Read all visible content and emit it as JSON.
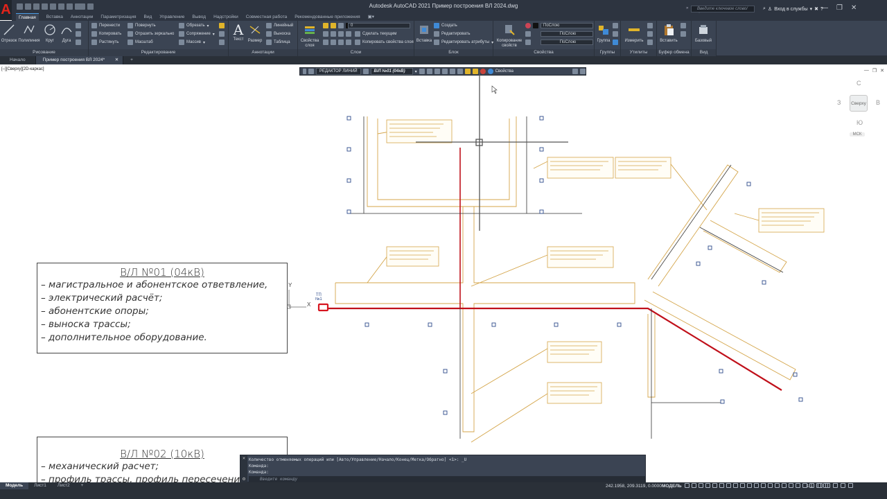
{
  "app": {
    "logo_letter": "A",
    "title": "Autodesk AutoCAD 2021    Пример построения ВЛ 2024.dwg",
    "search_placeholder": "Введите ключевое слово/фразу",
    "signin": "Вход в службы",
    "window_controls": [
      "—",
      "❐",
      "✕"
    ]
  },
  "ribbon_tabs": [
    "Главная",
    "Вставка",
    "Аннотации",
    "Параметризация",
    "Вид",
    "Управление",
    "Вывод",
    "Надстройки",
    "Совместная работа",
    "Рекомендованные приложения"
  ],
  "ribbon_active_tab": "Главная",
  "ribbon": {
    "draw": {
      "title": "Рисование",
      "buttons": [
        "Отрезок",
        "Полилиния",
        "Круг",
        "Дуга"
      ]
    },
    "modify": {
      "title": "Редактирование",
      "col1": [
        "Перенести",
        "Копировать",
        "Растянуть"
      ],
      "col2": [
        "Повернуть",
        "Отразить зеркально",
        "Масштаб"
      ],
      "col3": [
        "Обрезать",
        "Сопряжение",
        "Массив"
      ]
    },
    "annotation": {
      "title": "Аннотации",
      "buttons": [
        "Текст",
        "Размер"
      ],
      "small": [
        "Линейный",
        "Выноска",
        "Таблица"
      ]
    },
    "layers": {
      "title": "Слои",
      "big": "Свойства слоя",
      "layer_value": "0",
      "small": [
        "Сделать текущим",
        "Копировать свойства слоя"
      ]
    },
    "block": {
      "title": "Блок",
      "big": "Вставка",
      "small": [
        "Создать",
        "Редактировать",
        "Редактировать атрибуты"
      ]
    },
    "properties": {
      "title": "Свойства",
      "big": "Копирование свойств",
      "dropdowns": [
        "ПоСлою",
        "ПоСлою",
        "ПоСлою"
      ]
    },
    "groups": {
      "title": "Группы",
      "big": "Группа"
    },
    "utilities": {
      "title": "Утилиты",
      "big": "Измерить"
    },
    "clipboard": {
      "title": "Буфер обмена",
      "big": "Вставить"
    },
    "view": {
      "title": "Вид",
      "big": "Базовый"
    }
  },
  "doc_tabs": [
    "Начало",
    "Пример построения ВЛ 2024*",
    "+"
  ],
  "viewport": {
    "label": "[–][Сверху][2D-каркас]",
    "controls": [
      "—",
      "❐",
      "✕"
    ]
  },
  "editor_bar": {
    "title": "РЕДАКТОР ЛИНИЙ",
    "layer": "В/Л №01 (04кВ)",
    "properties": "Свойства"
  },
  "viewcube": {
    "n": "С",
    "s": "Ю",
    "w": "З",
    "e": "В",
    "face": "Сверху",
    "wcs": "МСК"
  },
  "notes": [
    {
      "title": "В/Л №01 (04кВ)",
      "lines": [
        "– магистральное и абонентское ответвление,",
        "– электрический расчёт;",
        "– абонентские опоры;",
        "– выноска трассы;",
        "– дополнительное оборудование."
      ]
    },
    {
      "title": "В/Л №02 (10кВ)",
      "lines": [
        "– механический расчет;",
        "– профиль трассы, профиль пересечения"
      ]
    }
  ],
  "drawing_labels": {
    "tp": "ТП",
    "tp_no": "№1",
    "ucs_y": "Y",
    "ucs_x": "X"
  },
  "commandline": {
    "history": "Количество отменяемых операций или [Авто/Управление/Начало/Конец/Метка/Обратно] <1>: _U",
    "line2": "Команда:",
    "line3": "Команда:",
    "placeholder": "Введите команду"
  },
  "layout_tabs": [
    "Модель",
    "Лист1",
    "Лист2"
  ],
  "status": {
    "coords": "242.1958, 209.3119, 0.0000",
    "space": "МОДЕЛЬ",
    "scale": "1:1"
  },
  "colors": {
    "ribbon": "#3b4453",
    "titlebar": "#2d3440",
    "canvas": "#ffffff",
    "line_red": "#c0101a",
    "callout": "#d4a54a",
    "accent": "#e2241b"
  }
}
